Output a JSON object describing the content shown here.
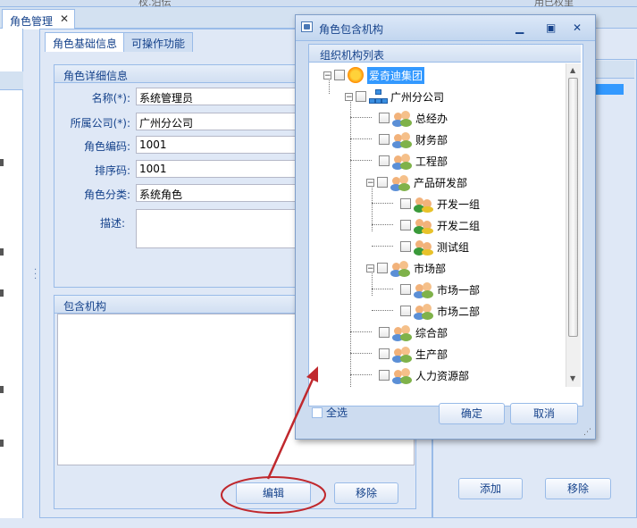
{
  "top_strip": {
    "left_text": "杈.泊伝",
    "right_text": "用已权里"
  },
  "tab": {
    "label": "角色管理",
    "close": "✕"
  },
  "subtabs": {
    "basic": "角色基础信息",
    "ops": "可操作功能"
  },
  "details": {
    "legend": "角色详细信息",
    "name_label": "名称(*):",
    "name_value": "系统管理员",
    "company_label": "所属公司(*):",
    "company_value": "广州分公司",
    "code_label": "角色编码:",
    "code_value": "1001",
    "order_label": "排序码:",
    "order_value": "1001",
    "category_label": "角色分类:",
    "category_value": "系统角色",
    "desc_label": "描述:"
  },
  "org_panel": {
    "legend": "包含机构",
    "edit_button": "编辑",
    "remove_button": "移除"
  },
  "right_panel": {
    "add_button": "添加",
    "remove_button": "移除"
  },
  "dialog": {
    "title": "角色包含机构",
    "tree_header": "组织机构列表",
    "tree": {
      "root": "爱奇迪集团",
      "branch": "广州分公司",
      "d1": "总经办",
      "d2": "财务部",
      "d3": "工程部",
      "d4": "产品研发部",
      "d4a": "开发一组",
      "d4b": "开发二组",
      "d4c": "测试组",
      "d5": "市场部",
      "d5a": "市场一部",
      "d5b": "市场二部",
      "d6": "综合部",
      "d7": "生产部",
      "d8": "人力资源部"
    },
    "select_all": "全选",
    "ok_button": "确定",
    "cancel_button": "取消"
  },
  "colors": {
    "accent": "#15428b",
    "border": "#99bbe8",
    "selection": "#3399ff",
    "annotation": "#c0282d"
  }
}
